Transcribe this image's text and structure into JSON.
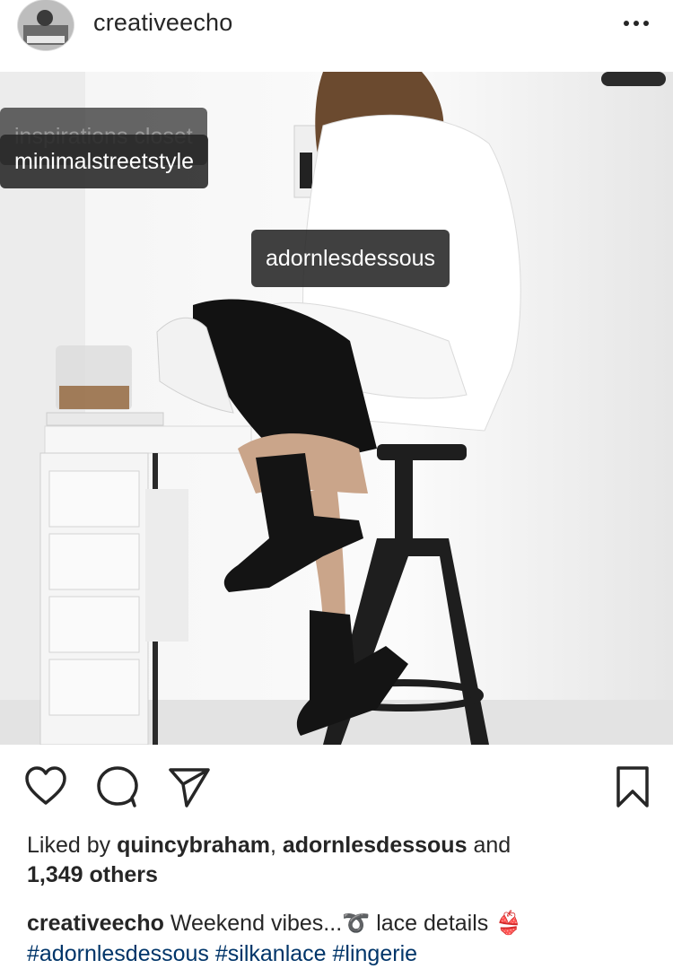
{
  "post": {
    "username": "creativeecho",
    "more_icon": "more-horizontal-icon",
    "photo_tags": [
      {
        "label": "inspirations closet"
      },
      {
        "label": "minimalstreetstyle"
      },
      {
        "label": "adornlesdessous"
      }
    ]
  },
  "actions": {
    "like_icon": "heart-icon",
    "comment_icon": "comment-icon",
    "share_icon": "send-icon",
    "save_icon": "bookmark-icon"
  },
  "likes": {
    "prefix": "Liked by",
    "user1": "quincybraham",
    "sep": ",",
    "user2": "adornlesdessous",
    "and": "and",
    "count": "1,349 others"
  },
  "caption": {
    "username": "creativeecho",
    "text": "Weekend vibes...➰ lace details 👙",
    "hashtags": [
      "#adornlesdessous",
      "#silkanlace",
      "#lingerie"
    ]
  },
  "colors": {
    "text": "#262626",
    "hashtag": "#003569",
    "tag_bg": "#262626",
    "divider": "#efefef"
  }
}
